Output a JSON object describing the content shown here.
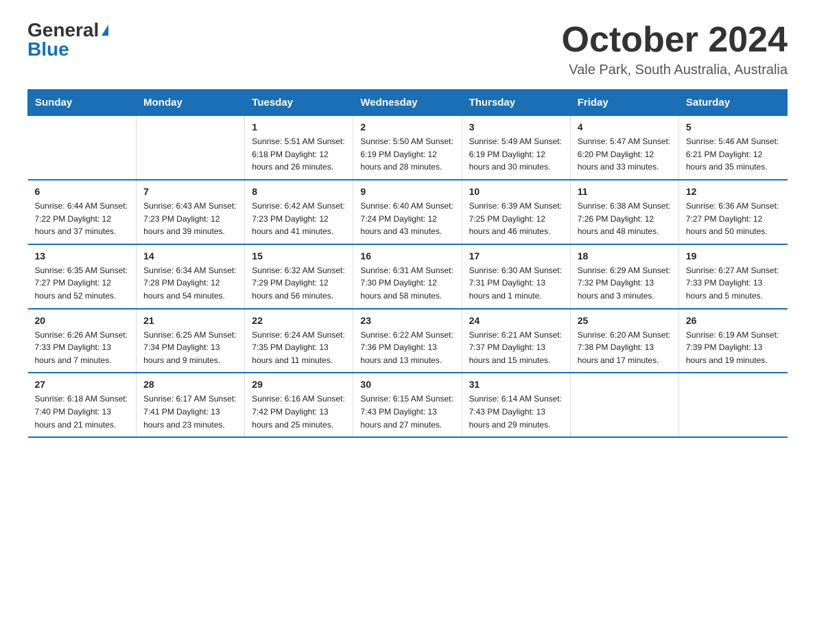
{
  "header": {
    "logo_general": "General",
    "logo_blue": "Blue",
    "month_title": "October 2024",
    "location": "Vale Park, South Australia, Australia"
  },
  "days_of_week": [
    "Sunday",
    "Monday",
    "Tuesday",
    "Wednesday",
    "Thursday",
    "Friday",
    "Saturday"
  ],
  "weeks": [
    [
      {
        "day": "",
        "info": ""
      },
      {
        "day": "",
        "info": ""
      },
      {
        "day": "1",
        "info": "Sunrise: 5:51 AM\nSunset: 6:18 PM\nDaylight: 12 hours\nand 26 minutes."
      },
      {
        "day": "2",
        "info": "Sunrise: 5:50 AM\nSunset: 6:19 PM\nDaylight: 12 hours\nand 28 minutes."
      },
      {
        "day": "3",
        "info": "Sunrise: 5:49 AM\nSunset: 6:19 PM\nDaylight: 12 hours\nand 30 minutes."
      },
      {
        "day": "4",
        "info": "Sunrise: 5:47 AM\nSunset: 6:20 PM\nDaylight: 12 hours\nand 33 minutes."
      },
      {
        "day": "5",
        "info": "Sunrise: 5:46 AM\nSunset: 6:21 PM\nDaylight: 12 hours\nand 35 minutes."
      }
    ],
    [
      {
        "day": "6",
        "info": "Sunrise: 6:44 AM\nSunset: 7:22 PM\nDaylight: 12 hours\nand 37 minutes."
      },
      {
        "day": "7",
        "info": "Sunrise: 6:43 AM\nSunset: 7:23 PM\nDaylight: 12 hours\nand 39 minutes."
      },
      {
        "day": "8",
        "info": "Sunrise: 6:42 AM\nSunset: 7:23 PM\nDaylight: 12 hours\nand 41 minutes."
      },
      {
        "day": "9",
        "info": "Sunrise: 6:40 AM\nSunset: 7:24 PM\nDaylight: 12 hours\nand 43 minutes."
      },
      {
        "day": "10",
        "info": "Sunrise: 6:39 AM\nSunset: 7:25 PM\nDaylight: 12 hours\nand 46 minutes."
      },
      {
        "day": "11",
        "info": "Sunrise: 6:38 AM\nSunset: 7:26 PM\nDaylight: 12 hours\nand 48 minutes."
      },
      {
        "day": "12",
        "info": "Sunrise: 6:36 AM\nSunset: 7:27 PM\nDaylight: 12 hours\nand 50 minutes."
      }
    ],
    [
      {
        "day": "13",
        "info": "Sunrise: 6:35 AM\nSunset: 7:27 PM\nDaylight: 12 hours\nand 52 minutes."
      },
      {
        "day": "14",
        "info": "Sunrise: 6:34 AM\nSunset: 7:28 PM\nDaylight: 12 hours\nand 54 minutes."
      },
      {
        "day": "15",
        "info": "Sunrise: 6:32 AM\nSunset: 7:29 PM\nDaylight: 12 hours\nand 56 minutes."
      },
      {
        "day": "16",
        "info": "Sunrise: 6:31 AM\nSunset: 7:30 PM\nDaylight: 12 hours\nand 58 minutes."
      },
      {
        "day": "17",
        "info": "Sunrise: 6:30 AM\nSunset: 7:31 PM\nDaylight: 13 hours\nand 1 minute."
      },
      {
        "day": "18",
        "info": "Sunrise: 6:29 AM\nSunset: 7:32 PM\nDaylight: 13 hours\nand 3 minutes."
      },
      {
        "day": "19",
        "info": "Sunrise: 6:27 AM\nSunset: 7:33 PM\nDaylight: 13 hours\nand 5 minutes."
      }
    ],
    [
      {
        "day": "20",
        "info": "Sunrise: 6:26 AM\nSunset: 7:33 PM\nDaylight: 13 hours\nand 7 minutes."
      },
      {
        "day": "21",
        "info": "Sunrise: 6:25 AM\nSunset: 7:34 PM\nDaylight: 13 hours\nand 9 minutes."
      },
      {
        "day": "22",
        "info": "Sunrise: 6:24 AM\nSunset: 7:35 PM\nDaylight: 13 hours\nand 11 minutes."
      },
      {
        "day": "23",
        "info": "Sunrise: 6:22 AM\nSunset: 7:36 PM\nDaylight: 13 hours\nand 13 minutes."
      },
      {
        "day": "24",
        "info": "Sunrise: 6:21 AM\nSunset: 7:37 PM\nDaylight: 13 hours\nand 15 minutes."
      },
      {
        "day": "25",
        "info": "Sunrise: 6:20 AM\nSunset: 7:38 PM\nDaylight: 13 hours\nand 17 minutes."
      },
      {
        "day": "26",
        "info": "Sunrise: 6:19 AM\nSunset: 7:39 PM\nDaylight: 13 hours\nand 19 minutes."
      }
    ],
    [
      {
        "day": "27",
        "info": "Sunrise: 6:18 AM\nSunset: 7:40 PM\nDaylight: 13 hours\nand 21 minutes."
      },
      {
        "day": "28",
        "info": "Sunrise: 6:17 AM\nSunset: 7:41 PM\nDaylight: 13 hours\nand 23 minutes."
      },
      {
        "day": "29",
        "info": "Sunrise: 6:16 AM\nSunset: 7:42 PM\nDaylight: 13 hours\nand 25 minutes."
      },
      {
        "day": "30",
        "info": "Sunrise: 6:15 AM\nSunset: 7:43 PM\nDaylight: 13 hours\nand 27 minutes."
      },
      {
        "day": "31",
        "info": "Sunrise: 6:14 AM\nSunset: 7:43 PM\nDaylight: 13 hours\nand 29 minutes."
      },
      {
        "day": "",
        "info": ""
      },
      {
        "day": "",
        "info": ""
      }
    ]
  ]
}
